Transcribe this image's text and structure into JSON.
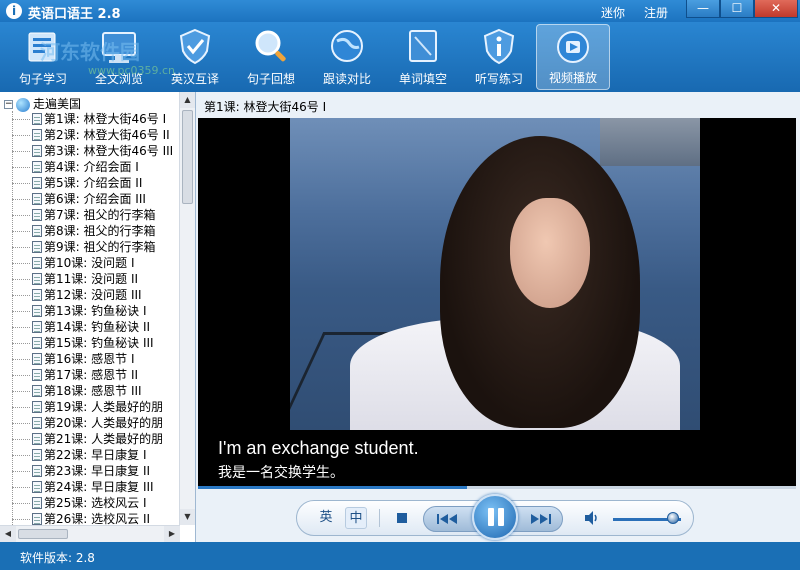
{
  "window": {
    "title": "英语口语王 2.8",
    "links": [
      "迷你",
      "注册"
    ],
    "controls": {
      "minimize": "—",
      "maximize": "☐",
      "close": "✕"
    }
  },
  "watermark": {
    "text": "河东软件园",
    "url": "www.pc0359.cn"
  },
  "toolbar": {
    "items": [
      {
        "label": "句子学习",
        "icon": "sentence-book-icon"
      },
      {
        "label": "全文浏览",
        "icon": "monitor-icon"
      },
      {
        "label": "英汉互译",
        "icon": "shield-check-icon"
      },
      {
        "label": "句子回想",
        "icon": "magnifier-icon"
      },
      {
        "label": "跟读对比",
        "icon": "globe-icon"
      },
      {
        "label": "单词填空",
        "icon": "notebook-icon"
      },
      {
        "label": "听写练习",
        "icon": "shield-info-icon"
      },
      {
        "label": "视频播放",
        "icon": "video-globe-icon"
      }
    ],
    "active": "视频播放"
  },
  "tree": {
    "root": "走遍美国",
    "items": [
      "第1课: 林登大街46号 I",
      "第2课: 林登大街46号 II",
      "第3课: 林登大街46号 III",
      "第4课: 介绍会面 I",
      "第5课: 介绍会面 II",
      "第6课: 介绍会面 III",
      "第7课: 祖父的行李箱",
      "第8课: 祖父的行李箱",
      "第9课: 祖父的行李箱",
      "第10课: 没问题 I",
      "第11课: 没问题 II",
      "第12课: 没问题 III",
      "第13课: 钓鱼秘诀 I",
      "第14课: 钓鱼秘诀 II",
      "第15课: 钓鱼秘诀 III",
      "第16课: 感恩节 I",
      "第17课: 感恩节 II",
      "第18课: 感恩节 III",
      "第19课: 人类最好的朋",
      "第20课: 人类最好的朋",
      "第21课: 人类最好的朋",
      "第22课: 早日康复 I",
      "第23课: 早日康复 II",
      "第24课: 早日康复 III",
      "第25课: 选校风云 I",
      "第26课: 选校风云 II"
    ]
  },
  "player": {
    "lesson_title": "第1课: 林登大街46号 I",
    "subtitle_en": "I'm an exchange student.",
    "subtitle_zh": "我是一名交换学生。",
    "progress": 0.45,
    "lang_en": "英",
    "lang_zh": "中",
    "volume": 0.85
  },
  "status": {
    "text": "软件版本: 2.8"
  },
  "colors": {
    "accent": "#1a6fb5",
    "player_bg": "#eaf1f8",
    "video_bg": "#000000"
  }
}
